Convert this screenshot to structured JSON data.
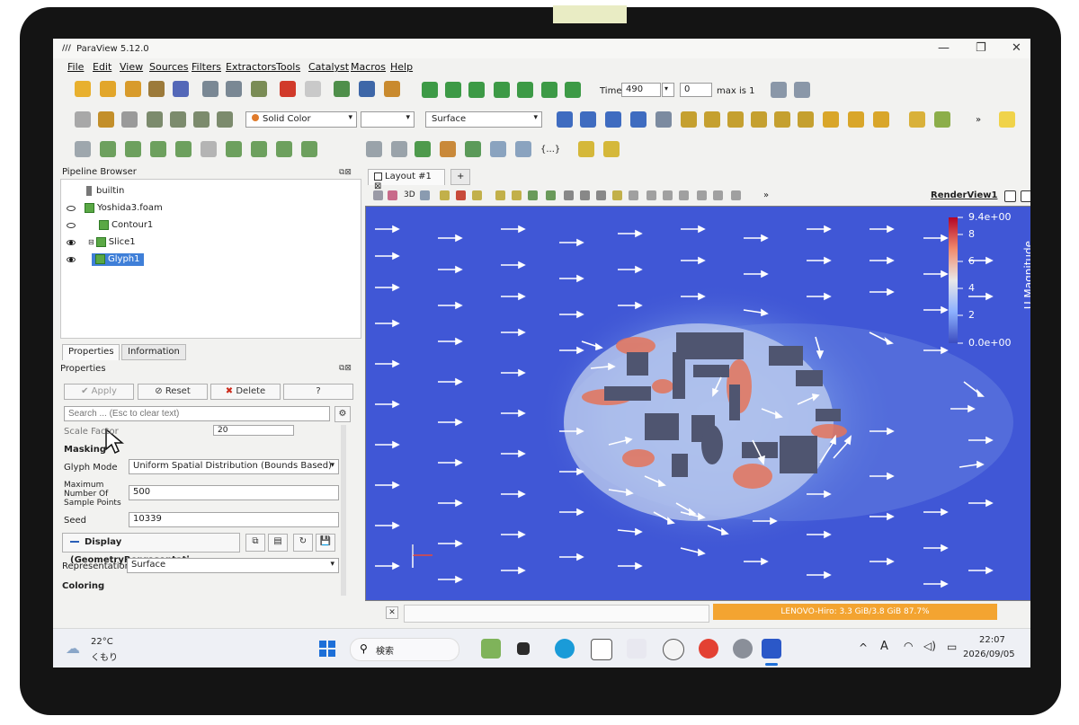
{
  "window": {
    "title": "ParaView 5.12.0",
    "logo": "///",
    "minimize": "—",
    "maximize": "❐",
    "close": "✕"
  },
  "menu": [
    "File",
    "Edit",
    "View",
    "Sources",
    "Filters",
    "Extractors",
    "Tools",
    "Catalyst",
    "Macros",
    "Help"
  ],
  "time_controls": {
    "label": "Time:",
    "value": "490",
    "index": "0",
    "max_label": "max is 1"
  },
  "display_toolbar": {
    "coloring": "Solid Color",
    "component": "",
    "representation": "Surface",
    "misc_label": "{...}",
    "overflow": "»"
  },
  "pipeline_browser": {
    "title": "Pipeline Browser",
    "items": [
      {
        "label": "builtin",
        "visible": false,
        "selected": false
      },
      {
        "label": "Yoshida3.foam",
        "visible": false,
        "selected": false
      },
      {
        "label": "Contour1",
        "visible": false,
        "selected": false
      },
      {
        "label": "Slice1",
        "visible": true,
        "selected": false
      },
      {
        "label": "Glyph1",
        "visible": true,
        "selected": true
      }
    ]
  },
  "tabs": {
    "properties": "Properties",
    "information": "Information"
  },
  "properties": {
    "title": "Properties",
    "apply": "Apply",
    "reset": "Reset",
    "delete": "Delete",
    "help": "?",
    "search_placeholder": "Search ... (Esc to clear text)",
    "cut_label": "Scale Factor",
    "cut_value": "20",
    "masking_header": "Masking",
    "glyph_mode_label": "Glyph Mode",
    "glyph_mode_value": "Uniform Spatial Distribution (Bounds Based)",
    "max_points_label": "Maximum Number Of Sample Points",
    "max_points_value": "500",
    "seed_label": "Seed",
    "seed_value": "10339",
    "display_header": "Display (GeometryRepresentati",
    "representation_label": "Representation",
    "representation_value": "Surface",
    "coloring_header": "Coloring"
  },
  "layout": {
    "tab": "Layout #1",
    "close": "⊠",
    "add": "+",
    "render_view": "RenderView1",
    "view_3d": "3D"
  },
  "legend": {
    "title": "U Magnitude",
    "max": "9.4e+00",
    "min": "0.0e+00",
    "ticks": [
      "8",
      "6",
      "4",
      "2"
    ]
  },
  "status": {
    "memory": "LENOVO-Hiro: 3.3 GiB/3.8 GiB 87.7%"
  },
  "taskbar": {
    "weather_temp": "22°C",
    "weather_desc": "くもり",
    "search": "検索",
    "time": "22:07",
    "date": "2026/09/05",
    "ime": "A"
  },
  "colors": {
    "accent": "#3f7fd8",
    "render_bg": "#3f55d4",
    "memory_bar": "#f3a431"
  }
}
